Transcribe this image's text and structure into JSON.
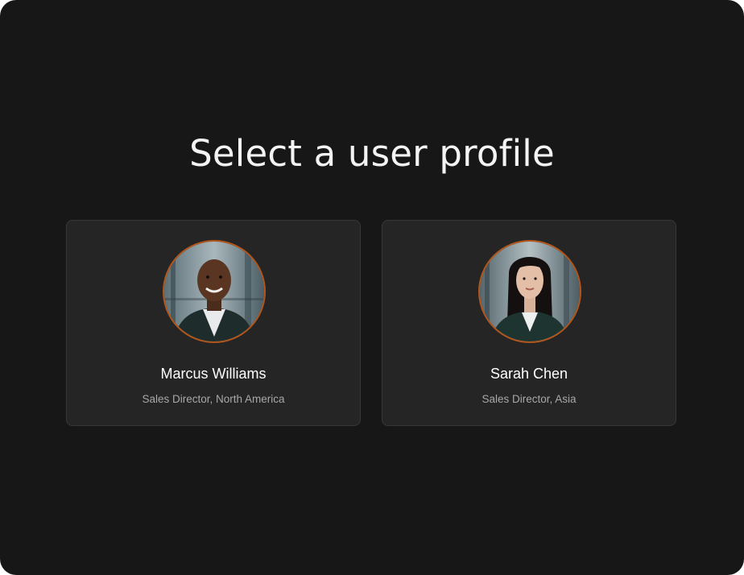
{
  "page": {
    "title": "Select a user profile"
  },
  "profiles": [
    {
      "name": "Marcus Williams",
      "role": "Sales Director, North America",
      "avatar_icon": "avatar-photo"
    },
    {
      "name": "Sarah Chen",
      "role": "Sales Director, Asia",
      "avatar_icon": "avatar-photo"
    }
  ],
  "colors": {
    "background": "#171717",
    "card": "#252525",
    "card_border": "#373737",
    "avatar_ring": "#b4561a",
    "title_text": "#f4f4f4",
    "role_text": "#a8a8a8"
  }
}
